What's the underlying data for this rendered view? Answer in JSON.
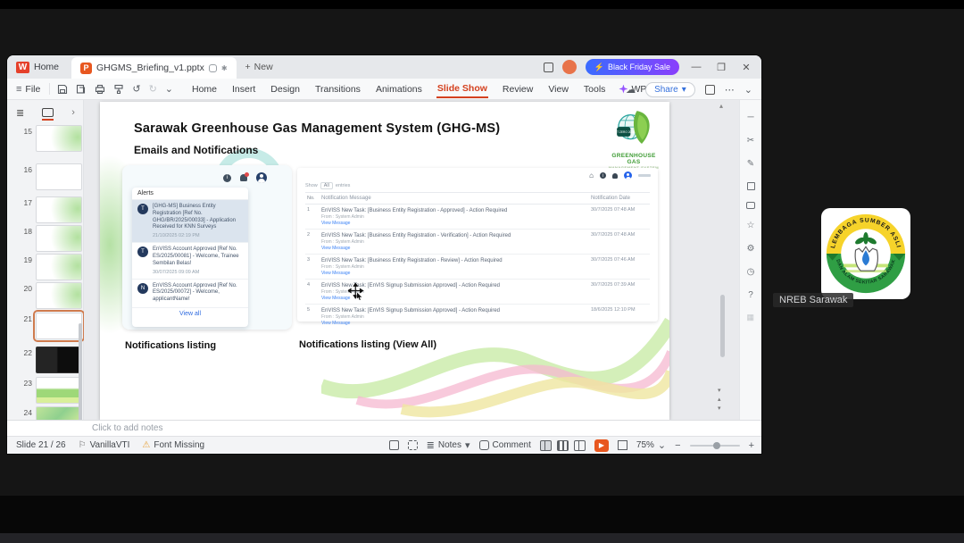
{
  "icons": {
    "lightning": "⚡",
    "minimize": "—",
    "restore": "❐",
    "close": "✕",
    "plus": "+",
    "chevron_down": "⌄",
    "chevron_right": "›",
    "undo": "↺",
    "redo": "↻",
    "cloud": "☁",
    "ellipsis": "⋯",
    "menu": "≡",
    "play": "▶",
    "warning": "⚠",
    "flag": "⚐",
    "minus": "−",
    "up_arrow": "▴",
    "down_arrow": "▾",
    "star": "☆",
    "scissors": "✂",
    "pencil": "✎",
    "gear": "⚙",
    "clock": "◷",
    "question": "?",
    "info": "i",
    "outline": "≣",
    "asterisk": "✱",
    "home": "⌂",
    "grid": "▦",
    "dash": "─"
  },
  "window": {
    "home_tab": "Home",
    "doc_tab": "GHGMS_Briefing_v1.pptx",
    "new_tab": "New",
    "promo_label": "Black Friday Sale",
    "file_menu": "File",
    "menus": [
      "Home",
      "Insert",
      "Design",
      "Transitions",
      "Animations",
      "Slide Show",
      "Review",
      "View",
      "Tools"
    ],
    "wps_ai": "WPS AI",
    "share_label": "Share"
  },
  "slide": {
    "title": "Sarawak Greenhouse Gas Management System (GHG-MS)",
    "subtitle": "Emails and Notifications",
    "logo": {
      "badge": "NET ZERO 2050",
      "name_line1": "GREENHOUSE GAS",
      "name_line2": "MANAGEMENT SYSTEM"
    },
    "caption_left": "Notifications listing",
    "caption_right": "Notifications listing (View All)",
    "alerts": {
      "header": "Alerts",
      "view_all": "View all",
      "items": [
        {
          "avatar": "T",
          "text": "[GHG-MS] Business Entity Registration [Ref No. GHG/BR/2025/00033] - Application Received for KNN Surveys",
          "time": "21/10/2025 02:19 PM"
        },
        {
          "avatar": "T",
          "text": "EnVISS Account Approved [Ref No. ES/2025/00081] - Welcome, Trainee Sembilan Belas!",
          "time": "30/07/2025 09:09 AM"
        },
        {
          "avatar": "N",
          "text": "EnVISS Account Approved [Ref No. ES/2025/00072] - Welcome, applicantName!",
          "time": ""
        }
      ]
    },
    "portal": {
      "show_label": "Show",
      "show_value": "All",
      "entries_label": "entries",
      "col_no": "No.",
      "col_message": "Notification Message",
      "col_date": "Notification Date",
      "from_label": "From : System Admin",
      "view_link": "View Message",
      "rows": [
        {
          "no": "1",
          "msg": "EnVISS New Task: [Business Entity Registration - Approved] - Action Required",
          "date": "30/7/2025 07:48 AM"
        },
        {
          "no": "2",
          "msg": "EnVISS New Task: [Business Entity Registration - Verification] - Action Required",
          "date": "30/7/2025 07:48 AM"
        },
        {
          "no": "3",
          "msg": "EnVISS New Task: [Business Entity Registration - Review] - Action Required",
          "date": "30/7/2025 07:46 AM"
        },
        {
          "no": "4",
          "msg": "EnVISS New Task: [EnVIS Signup Submission Approved] - Action Required",
          "date": "30/7/2025 07:39 AM"
        },
        {
          "no": "5",
          "msg": "EnVISS New Task: [EnVIS Signup Submission Approved] - Action Required",
          "date": "18/6/2025 12:10 PM"
        }
      ]
    }
  },
  "thumbnails": {
    "numbers": [
      "15",
      "16",
      "17",
      "18",
      "19",
      "20",
      "21",
      "22",
      "23",
      "24"
    ],
    "selected": "21"
  },
  "notes": {
    "placeholder": "Click to add notes"
  },
  "statusbar": {
    "slide_info": "Slide 21 / 26",
    "theme_name": "VanillaVTI",
    "font_missing": "Font Missing",
    "notes_label": "Notes",
    "comment_label": "Comment",
    "zoom_value": "75%"
  },
  "meeting": {
    "participant": "NREB Sarawak",
    "logo_arc_top": "LEMBAGA SUMBER ASLI",
    "logo_arc_bottom": "DAN ALAM SEKITAR SARAWAK"
  }
}
